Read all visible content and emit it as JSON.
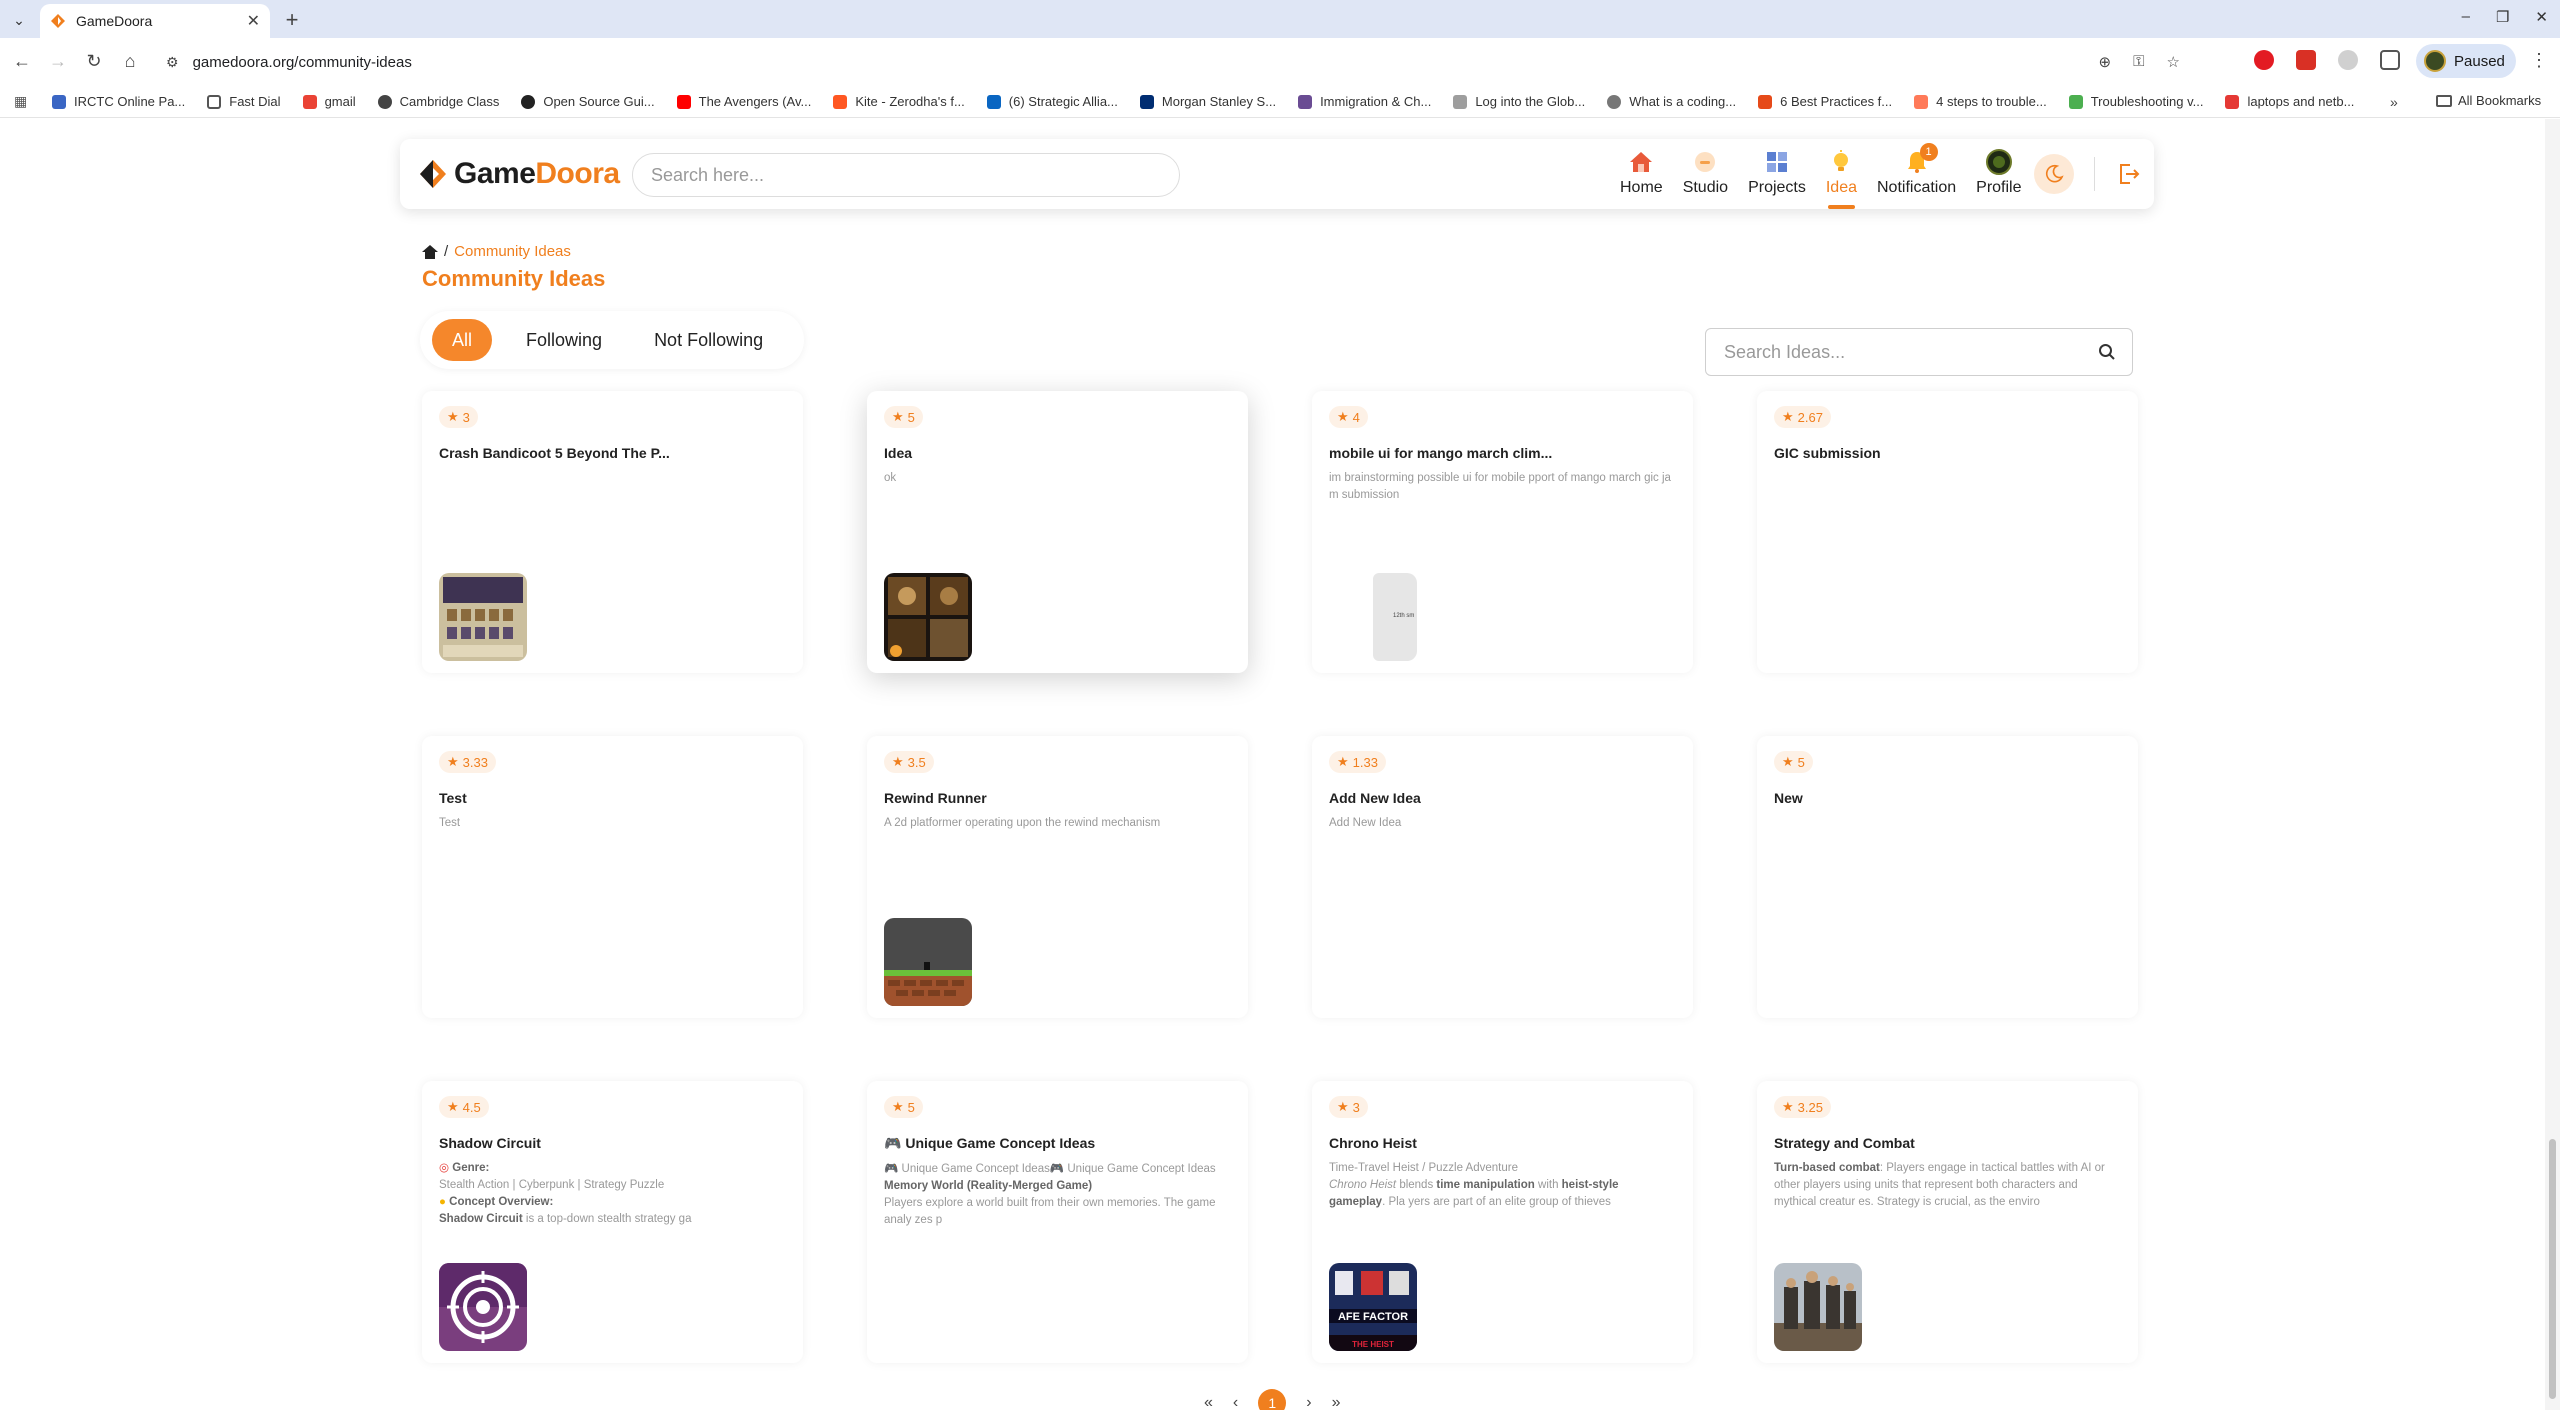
{
  "browser": {
    "tab_title": "GameDoora",
    "url": "gamedoora.org/community-ideas",
    "profile_label": "Paused",
    "bookmarks": [
      "IRCTC Online Pa...",
      "Fast Dial",
      "gmail",
      "Cambridge Class",
      "Open Source Gui...",
      "The Avengers (Av...",
      "Kite - Zerodha's f...",
      "(6) Strategic Allia...",
      "Morgan Stanley S...",
      "Immigration & Ch...",
      "Log into the Glob...",
      "What is a coding...",
      "6 Best Practices f...",
      "4 steps to trouble...",
      "Troubleshooting v...",
      "laptops and netb..."
    ],
    "all_bookmarks_label": "All Bookmarks"
  },
  "site": {
    "logo_game": "Game",
    "logo_doora": "Doora",
    "search_placeholder": "Search here...",
    "nav": [
      {
        "label": "Home",
        "icon": "home-icon"
      },
      {
        "label": "Studio",
        "icon": "studio-icon"
      },
      {
        "label": "Projects",
        "icon": "projects-icon"
      },
      {
        "label": "Idea",
        "icon": "idea-icon",
        "active": true
      },
      {
        "label": "Notification",
        "icon": "bell-icon",
        "badge": "1"
      },
      {
        "label": "Profile",
        "icon": "avatar"
      }
    ],
    "accent_color": "#f07f1e"
  },
  "breadcrumb": {
    "sep": "/",
    "current": "Community Ideas"
  },
  "page_title": "Community Ideas",
  "filters": {
    "all": "All",
    "following": "Following",
    "not_following": "Not Following",
    "selected": "All"
  },
  "ideas_search_placeholder": "Search Ideas...",
  "ideas": [
    {
      "rating": "3",
      "title": "Crash Bandicoot 5 Beyond The P...",
      "desc": "",
      "thumb": "crash-bandicoot-thumb"
    },
    {
      "rating": "5",
      "title": "Idea",
      "desc": "ok",
      "thumb": "idea-thumb"
    },
    {
      "rating": "4",
      "title": "mobile ui for mango march clim...",
      "desc": "im brainstorming possible ui for mobile pport of mango march gic ja m submission",
      "thumb": "mobile-ui-thumb",
      "thumb_text": "12th sm"
    },
    {
      "rating": "2.67",
      "title": "GIC submission",
      "desc": ""
    },
    {
      "rating": "3.33",
      "title": "Test",
      "desc": "Test"
    },
    {
      "rating": "3.5",
      "title": "Rewind Runner",
      "desc": "A 2d platformer operating upon the rewind mechanism",
      "thumb": "rewind-runner-thumb"
    },
    {
      "rating": "1.33",
      "title": "Add New Idea",
      "desc": "Add New Idea"
    },
    {
      "rating": "5",
      "title": "New",
      "desc": ""
    },
    {
      "rating": "4.5",
      "title": "Shadow Circuit",
      "desc_lines": {
        "genre_label": "Genre:",
        "genre": "Stealth Action | Cyberpunk | Strategy Puzzle",
        "overview_label": "Concept Overview:",
        "overview_name": "Shadow Circuit",
        "overview_text": " is a top-down stealth strategy ga"
      },
      "thumb": "shadow-circuit-thumb"
    },
    {
      "rating": "5",
      "title": "Unique Game Concept Ideas",
      "desc_lines": {
        "line1": "Unique Game Concept Ideas",
        "line1b": "Unique Game Concept Ideas",
        "heading": "Memory World (Reality-Merged Game)",
        "body": "Players explore a world built from their own memories. The game analy zes p"
      }
    },
    {
      "rating": "3",
      "title": "Chrono Heist",
      "desc_lines": {
        "genre": "Time-Travel Heist / Puzzle Adventure",
        "name": "Chrono Heist",
        "blends": " blends ",
        "tm": "time manipulation",
        "with": " with ",
        "heist": "heist-style gameplay",
        "rest": ". Pla yers are part of an elite group of thieves"
      },
      "thumb": "chrono-heist-thumb",
      "thumb_text_1": "AFE FACTOR",
      "thumb_text_2": "THE HEIST"
    },
    {
      "rating": "3.25",
      "title": "Strategy and Combat",
      "desc_lines": {
        "label": "Turn-based combat",
        "body": ": Players engage in tactical battles with AI or other players using units that represent both characters and mythical creatur es. Strategy is crucial, as the enviro"
      },
      "thumb": "strategy-combat-thumb"
    }
  ],
  "pagination": {
    "current": "1"
  }
}
